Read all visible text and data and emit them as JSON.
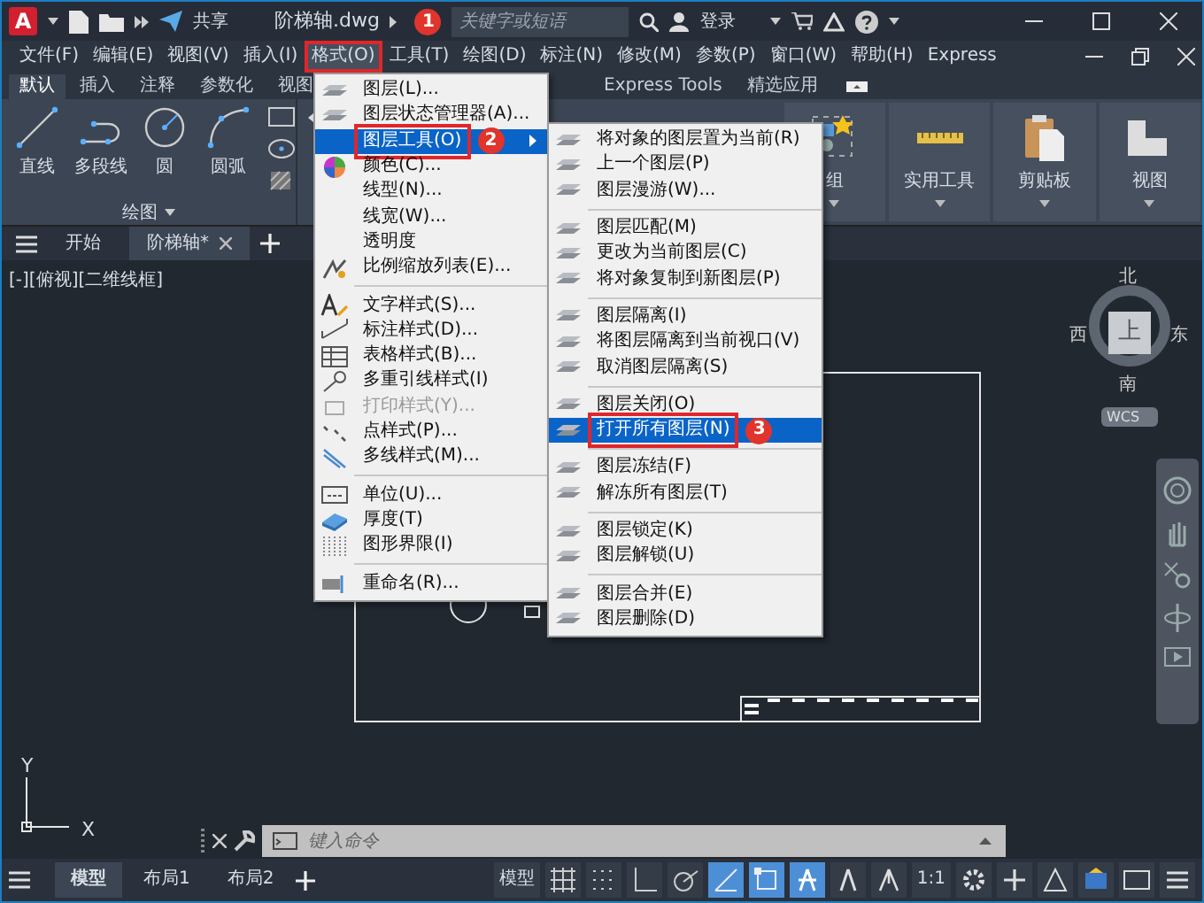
{
  "title_bar": {
    "app_logo": "A",
    "share": "共享",
    "file_name": "阶梯轴.dwg",
    "search": {
      "placeholder": "关键字或短语"
    },
    "sign_in": "登录"
  },
  "menu_bar": [
    {
      "label": "文件(F)",
      "selected": false
    },
    {
      "label": "编辑(E)",
      "selected": false
    },
    {
      "label": "视图(V)",
      "selected": false
    },
    {
      "label": "插入(I)",
      "selected": false
    },
    {
      "label": "格式(O)",
      "selected": true
    },
    {
      "label": "工具(T)",
      "selected": false
    },
    {
      "label": "绘图(D)",
      "selected": false
    },
    {
      "label": "标注(N)",
      "selected": false
    },
    {
      "label": "修改(M)",
      "selected": false
    },
    {
      "label": "参数(P)",
      "selected": false
    },
    {
      "label": "窗口(W)",
      "selected": false
    },
    {
      "label": "帮助(H)",
      "selected": false
    },
    {
      "label": "Express",
      "selected": false
    }
  ],
  "ribbon_tabs": [
    {
      "label": "默认",
      "selected": true
    },
    {
      "label": "插入",
      "selected": false
    },
    {
      "label": "注释",
      "selected": false
    },
    {
      "label": "参数化",
      "selected": false
    },
    {
      "label": "视图",
      "selected": false
    },
    {
      "label": "Express Tools",
      "selected": false
    },
    {
      "label": "精选应用",
      "selected": false
    }
  ],
  "ribbon": {
    "draw_tools": [
      {
        "label": "直线"
      },
      {
        "label": "多段线"
      },
      {
        "label": "圆"
      },
      {
        "label": "圆弧"
      }
    ],
    "panel_label": "绘图",
    "buttons": [
      {
        "label": "组"
      },
      {
        "label": "实用工具"
      },
      {
        "label": "剪贴板"
      },
      {
        "label": "视图"
      }
    ]
  },
  "doc_tabs": [
    {
      "label": "开始",
      "selected": false
    },
    {
      "label": "阶梯轴*",
      "selected": true
    }
  ],
  "viewport_label": "[-][俯视][二维线框]",
  "viewcube": {
    "face": "上",
    "north": "北",
    "south": "南",
    "east": "东",
    "west": "西",
    "wcs": "WCS"
  },
  "ucs": {
    "y": "Y",
    "x": "X"
  },
  "format_menu": [
    {
      "kind": "item",
      "label": "图层(L)...",
      "selected": false,
      "disabled": false,
      "submenu": false
    },
    {
      "kind": "item",
      "label": "图层状态管理器(A)...",
      "selected": false,
      "disabled": false,
      "submenu": false
    },
    {
      "kind": "item",
      "label": "图层工具(O)",
      "selected": true,
      "disabled": false,
      "submenu": true
    },
    {
      "kind": "item",
      "label": "颜色(C)...",
      "selected": false,
      "disabled": false,
      "submenu": false
    },
    {
      "kind": "item",
      "label": "线型(N)...",
      "selected": false,
      "disabled": false,
      "submenu": false
    },
    {
      "kind": "item",
      "label": "线宽(W)...",
      "selected": false,
      "disabled": false,
      "submenu": false
    },
    {
      "kind": "item",
      "label": "透明度",
      "selected": false,
      "disabled": false,
      "submenu": false
    },
    {
      "kind": "item",
      "label": "比例缩放列表(E)...",
      "selected": false,
      "disabled": false,
      "submenu": false
    },
    {
      "kind": "separator"
    },
    {
      "kind": "item",
      "label": "文字样式(S)...",
      "selected": false,
      "disabled": false,
      "submenu": false
    },
    {
      "kind": "item",
      "label": "标注样式(D)...",
      "selected": false,
      "disabled": false,
      "submenu": false
    },
    {
      "kind": "item",
      "label": "表格样式(B)...",
      "selected": false,
      "disabled": false,
      "submenu": false
    },
    {
      "kind": "item",
      "label": "多重引线样式(I)",
      "selected": false,
      "disabled": false,
      "submenu": false
    },
    {
      "kind": "item",
      "label": "打印样式(Y)...",
      "selected": false,
      "disabled": true,
      "submenu": false
    },
    {
      "kind": "item",
      "label": "点样式(P)...",
      "selected": false,
      "disabled": false,
      "submenu": false
    },
    {
      "kind": "item",
      "label": "多线样式(M)...",
      "selected": false,
      "disabled": false,
      "submenu": false
    },
    {
      "kind": "separator"
    },
    {
      "kind": "item",
      "label": "单位(U)...",
      "selected": false,
      "disabled": false,
      "submenu": false
    },
    {
      "kind": "item",
      "label": "厚度(T)",
      "selected": false,
      "disabled": false,
      "submenu": false
    },
    {
      "kind": "item",
      "label": "图形界限(I)",
      "selected": false,
      "disabled": false,
      "submenu": false
    },
    {
      "kind": "separator"
    },
    {
      "kind": "item",
      "label": "重命名(R)...",
      "selected": false,
      "disabled": false,
      "submenu": false
    }
  ],
  "layer_tools_menu": [
    {
      "kind": "item",
      "label": "将对象的图层置为当前(R)",
      "selected": false
    },
    {
      "kind": "item",
      "label": "上一个图层(P)",
      "selected": false
    },
    {
      "kind": "item",
      "label": "图层漫游(W)...",
      "selected": false
    },
    {
      "kind": "separator"
    },
    {
      "kind": "item",
      "label": "图层匹配(M)",
      "selected": false
    },
    {
      "kind": "item",
      "label": "更改为当前图层(C)",
      "selected": false
    },
    {
      "kind": "item",
      "label": "将对象复制到新图层(P)",
      "selected": false
    },
    {
      "kind": "separator"
    },
    {
      "kind": "item",
      "label": "图层隔离(I)",
      "selected": false
    },
    {
      "kind": "item",
      "label": "将图层隔离到当前视口(V)",
      "selected": false
    },
    {
      "kind": "item",
      "label": "取消图层隔离(S)",
      "selected": false
    },
    {
      "kind": "separator"
    },
    {
      "kind": "item",
      "label": "图层关闭(O)",
      "selected": false
    },
    {
      "kind": "item",
      "label": "打开所有图层(N)",
      "selected": true
    },
    {
      "kind": "separator"
    },
    {
      "kind": "item",
      "label": "图层冻结(F)",
      "selected": false
    },
    {
      "kind": "item",
      "label": "解冻所有图层(T)",
      "selected": false
    },
    {
      "kind": "separator"
    },
    {
      "kind": "item",
      "label": "图层锁定(K)",
      "selected": false
    },
    {
      "kind": "item",
      "label": "图层解锁(U)",
      "selected": false
    },
    {
      "kind": "separator"
    },
    {
      "kind": "item",
      "label": "图层合并(E)",
      "selected": false
    },
    {
      "kind": "item",
      "label": "图层删除(D)",
      "selected": false
    }
  ],
  "callouts": [
    {
      "number": "1"
    },
    {
      "number": "2"
    },
    {
      "number": "3"
    }
  ],
  "command_line": {
    "placeholder": "键入命令"
  },
  "layout_tabs": [
    {
      "label": "模型",
      "selected": true
    },
    {
      "label": "布局1",
      "selected": false
    },
    {
      "label": "布局2",
      "selected": false
    }
  ],
  "status_bar": {
    "model_button": "模型",
    "scale": "1:1"
  }
}
